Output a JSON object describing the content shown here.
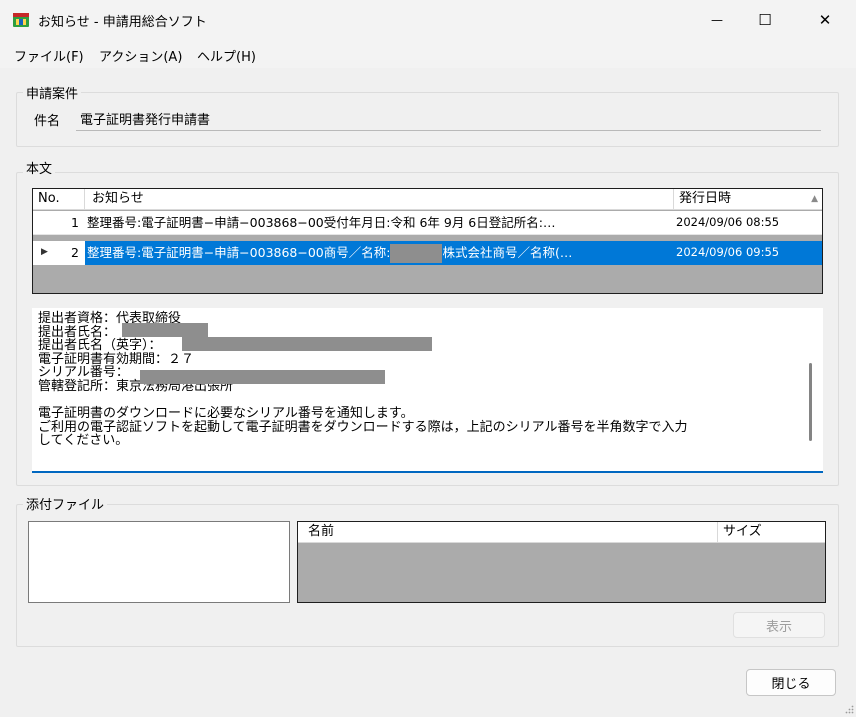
{
  "window": {
    "title": "お知らせ - 申請用総合ソフト",
    "minimize_glyph": "—",
    "maximize_glyph": "☐",
    "close_glyph": "✕",
    "icon": "app-icon"
  },
  "menu": {
    "items": [
      "ファイル(F)",
      "アクション(A)",
      "ヘルプ(H)"
    ]
  },
  "case": {
    "group_label": "申請案件",
    "subject_label": "件名",
    "subject_value": "電子証明書発行申請書"
  },
  "body": {
    "group_label": "本文",
    "columns": [
      "No.",
      "お知らせ",
      "発行日時"
    ],
    "sort_glyph": "▲",
    "row_pointer_glyph": "▶",
    "rows": [
      {
        "no": "1",
        "text_before": "整理番号:電子証明書−申請−003868−00受付年月日:令和 6年 9月 6日登記所名:…",
        "text_after": "",
        "has_redaction": false,
        "date": "2024/09/06 08:55"
      },
      {
        "no": "2",
        "text_before": "整理番号:電子証明書−申請−003868−00商号／名称:",
        "text_after": "株式会社商号／名称(…",
        "has_redaction": true,
        "date": "2024/09/06 09:55"
      }
    ]
  },
  "message": {
    "lines": [
      "提出者資格：代表取締役",
      "提出者氏名：",
      "提出者氏名（英字）：",
      "電子証明書有効期間：２７",
      "シリアル番号：",
      "管轄登記所：東京法務局港出張所",
      "",
      "電子証明書のダウンロードに必要なシリアル番号を通知します。",
      "ご利用の電子認証ソフトを起動して電子証明書をダウンロードする際は，上記のシリアル番号を半角数字で入力",
      "してください。"
    ]
  },
  "attachments": {
    "group_label": "添付ファイル",
    "columns": [
      "名前",
      "サイズ"
    ],
    "view_button": "表示"
  },
  "footer": {
    "close_button": "閉じる"
  },
  "colors": {
    "selection": "#0078d7",
    "grid_empty": "#ababab",
    "redaction": "#8e8e8e",
    "focus_underline": "#0067c0"
  }
}
